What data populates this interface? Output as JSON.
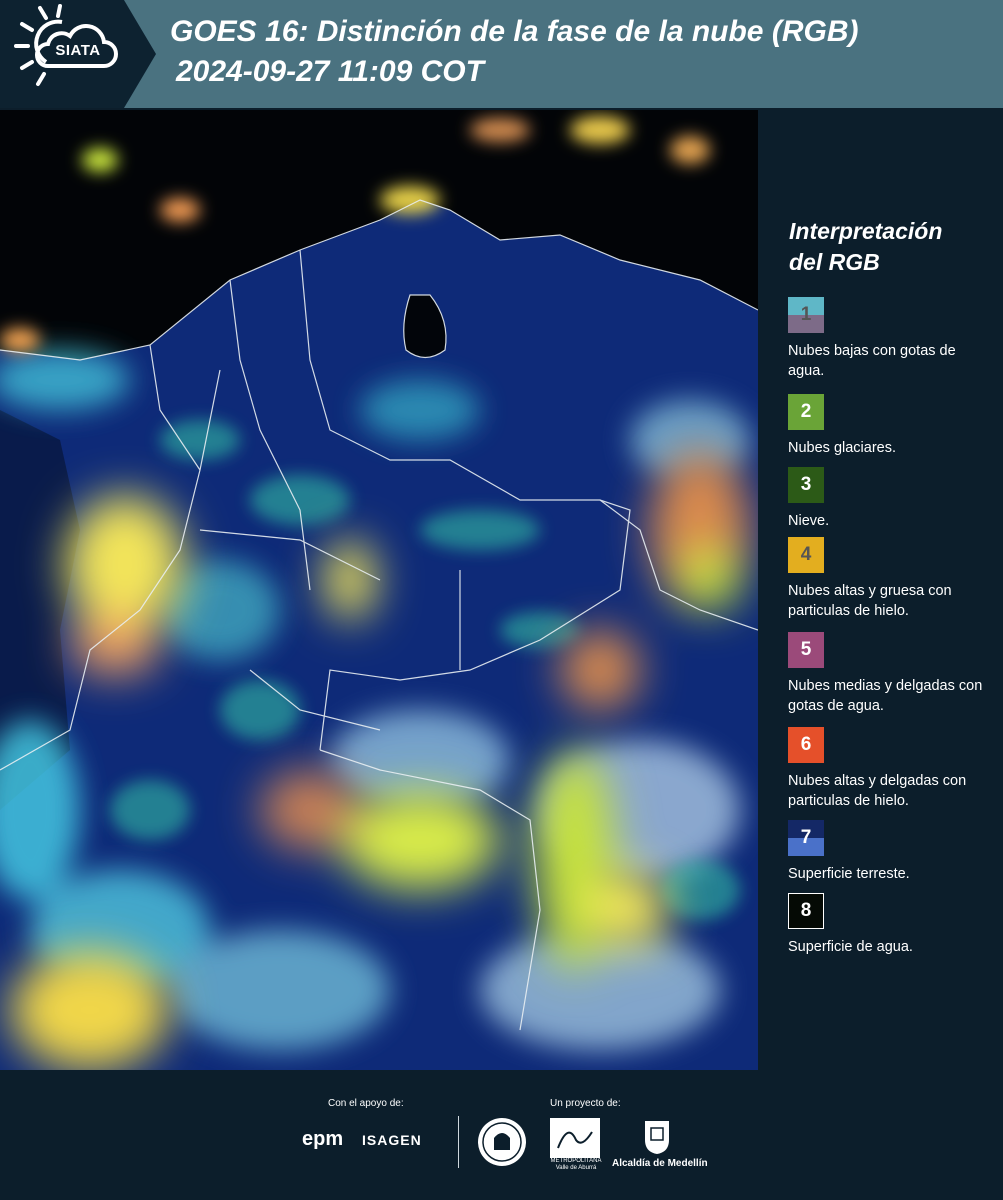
{
  "header": {
    "logo_text": "SIATA",
    "title": "GOES 16: Distinción de la fase de la nube (RGB)",
    "subtitle": "2024-09-27 11:09 COT"
  },
  "legend": {
    "title_line1": "Interpretación",
    "title_line2": "del RGB",
    "items": [
      {
        "number": "1",
        "label": "Nubes bajas con gotas de agua.",
        "color_top": "#5fb7c7",
        "color_bottom": "#7d6b88",
        "text_color": "#555555"
      },
      {
        "number": "2",
        "label": "Nubes glaciares.",
        "color": "#6aa437",
        "text_color": "#ffffff"
      },
      {
        "number": "3",
        "label": "Nieve.",
        "color": "#2c5a17",
        "text_color": "#ffffff"
      },
      {
        "number": "4",
        "label": "Nubes altas y gruesa con particulas de hielo.",
        "color": "#e3ae1f",
        "text_color": "#555555"
      },
      {
        "number": "5",
        "label": "Nubes medias y delgadas con gotas de agua.",
        "color": "#9b4a7a",
        "text_color": "#ffffff"
      },
      {
        "number": "6",
        "label": "Nubes altas y delgadas con particulas de hielo.",
        "color": "#e5502a",
        "text_color": "#ffffff"
      },
      {
        "number": "7",
        "label": "Superficie terreste.",
        "color_top": "#142866",
        "color_bottom": "#4a71c9",
        "text_color": "#ffffff"
      },
      {
        "number": "8",
        "label": "Superficie de agua.",
        "color": "#050a05",
        "border": "#ffffff",
        "text_color": "#ffffff"
      }
    ]
  },
  "footer": {
    "support_label": "Con el apoyo de:",
    "project_label": "Un proyecto de:",
    "epm": "epm",
    "isagen": "ISAGEN",
    "area_label": "METROPOLITANA Valle de Aburrá",
    "alcaldia": "Alcaldía de Medellín"
  },
  "icons": [
    "sun-icon",
    "cloud-icon",
    "seal-icon",
    "area-logo-icon",
    "coat-of-arms-icon"
  ]
}
